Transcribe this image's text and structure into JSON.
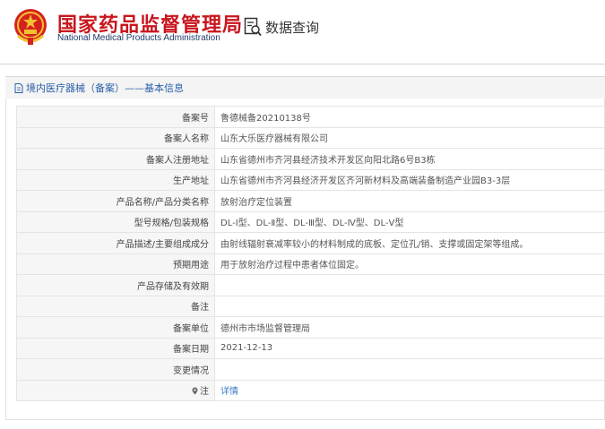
{
  "header": {
    "title_cn": "国家药品监督管理局",
    "title_en": "National Medical Products Administration",
    "query_label": "数据查询"
  },
  "section": {
    "title": "境内医疗器械（备案）——基本信息"
  },
  "rows": [
    {
      "label": "备案号",
      "value": "鲁德械备20210138号"
    },
    {
      "label": "备案人名称",
      "value": "山东大乐医疗器械有限公司"
    },
    {
      "label": "备案人注册地址",
      "value": "山东省德州市齐河县经济技术开发区向阳北路6号B3栋"
    },
    {
      "label": "生产地址",
      "value": "山东省德州市齐河县经济开发区齐河新材料及高端装备制造产业园B3-3层"
    },
    {
      "label": "产品名称/产品分类名称",
      "value": "放射治疗定位装置"
    },
    {
      "label": "型号规格/包装规格",
      "value": "DL-Ⅰ型、DL-Ⅱ型、DL-Ⅲ型、DL-Ⅳ型、DL-Ⅴ型"
    },
    {
      "label": "产品描述/主要组成成分",
      "value": "由射线辐射衰减率较小的材料制成的底板、定位孔/销、支撑或固定架等组成。"
    },
    {
      "label": "预期用途",
      "value": "用于放射治疗过程中患者体位固定。"
    },
    {
      "label": "产品存储及有效期",
      "value": ""
    },
    {
      "label": "备注",
      "value": ""
    },
    {
      "label": "备案单位",
      "value": "德州市市场监督管理局"
    },
    {
      "label": "备案日期",
      "value": "2021-12-13"
    },
    {
      "label": "变更情况",
      "value": ""
    },
    {
      "label": "注",
      "value": "详情"
    }
  ],
  "colors": {
    "brand_red": "#c8161d",
    "brand_blue": "#1f3a6b",
    "link_blue": "#3a78c3"
  },
  "icons": [
    "national-emblem-icon",
    "data-query-icon",
    "document-icon",
    "pin-icon"
  ]
}
